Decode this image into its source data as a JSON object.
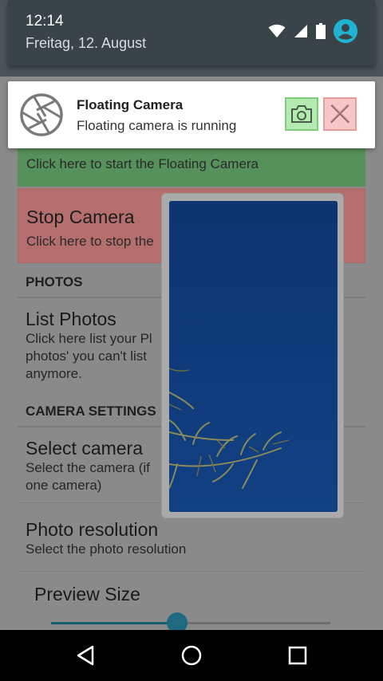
{
  "status_bar": {
    "time": "12:14",
    "date": "Freitag, 12. August",
    "icons": [
      "wifi-icon",
      "signal-icon",
      "battery-icon",
      "account-icon"
    ],
    "accent": "#1fb3d1"
  },
  "notification": {
    "app_name": "Floating Camera",
    "text": "Floating camera is running",
    "icon": "camera-shutter-icon",
    "actions": [
      {
        "name": "take-photo",
        "icon": "camera-icon",
        "color": "#b4ebb1"
      },
      {
        "name": "close",
        "icon": "close-icon",
        "color": "#f7c6c6"
      }
    ]
  },
  "app": {
    "start_row": {
      "subtitle": "Click here to start the Floating Camera",
      "color": "#56905a"
    },
    "stop_row": {
      "title": "Stop Camera",
      "subtitle": "Click here to stop the",
      "color": "#b56e6e"
    },
    "photos_section": "PHOTOS",
    "list_photos": {
      "title": "List Photos",
      "subtitle": "Click here list your Pl\nphotos' you can't list\nanymore."
    },
    "camera_settings_section": "CAMERA SETTINGS",
    "select_camera": {
      "title": "Select camera",
      "subtitle": "Select the camera (if\none camera)"
    },
    "photo_resolution": {
      "title": "Photo resolution",
      "subtitle": "Select the photo resolution"
    },
    "preview_size": {
      "title": "Preview Size",
      "value_fraction": 0.45
    }
  },
  "floating_window": {
    "content": "camera-preview",
    "sky_color": "#0e3a78"
  },
  "nav_bar": {
    "buttons": [
      "back-icon",
      "home-icon",
      "recents-icon"
    ]
  }
}
